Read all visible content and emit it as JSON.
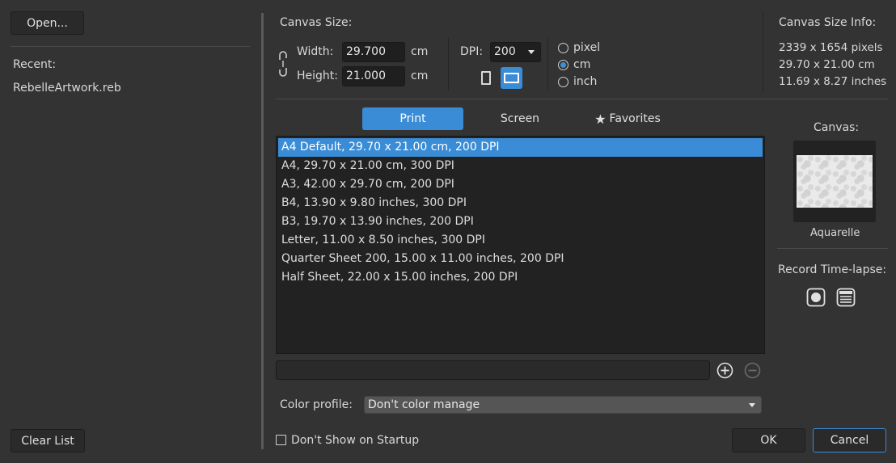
{
  "left_panel": {
    "open_label": "Open...",
    "recent_label": "Recent:",
    "recent_files": [
      "RebelleArtwork.reb"
    ],
    "clear_label": "Clear List"
  },
  "canvas_size": {
    "title": "Canvas Size:",
    "width_label": "Width:",
    "width_value": "29.700",
    "width_unit": "cm",
    "height_label": "Height:",
    "height_value": "21.000",
    "height_unit": "cm",
    "dpi_label": "DPI:",
    "dpi_value": "200",
    "orientation_selected": "landscape",
    "units": [
      {
        "label": "pixel",
        "selected": false
      },
      {
        "label": "cm",
        "selected": true
      },
      {
        "label": "inch",
        "selected": false
      }
    ]
  },
  "info": {
    "title": "Canvas Size Info:",
    "pixels": "2339 x 1654 pixels",
    "cm": "29.70 x 21.00 cm",
    "inches": "11.69 x 8.27 inches"
  },
  "tabs": [
    {
      "label": "Print",
      "active": true
    },
    {
      "label": "Screen",
      "active": false
    },
    {
      "label": "Favorites",
      "active": false
    }
  ],
  "presets": [
    "A4 Default, 29.70 x 21.00 cm, 200 DPI",
    "A4, 29.70 x 21.00 cm, 300 DPI",
    "A3, 42.00 x 29.70 cm, 200 DPI",
    "B4, 13.90 x 9.80 inches, 300 DPI",
    "B3, 19.70 x 13.90 inches, 200 DPI",
    "Letter, 11.00 x 8.50 inches, 300 DPI",
    "Quarter Sheet 200, 15.00 x 11.00 inches, 200 DPI",
    "Half Sheet, 22.00 x 15.00 inches, 200 DPI"
  ],
  "preset_name_value": "",
  "color_profile": {
    "label": "Color profile:",
    "value": "Don't color manage"
  },
  "canvas_panel": {
    "title": "Canvas:",
    "texture_name": "Aquarelle",
    "timelapse_title": "Record Time-lapse:"
  },
  "footer": {
    "dont_show_label": "Don't Show on Startup",
    "ok_label": "OK",
    "cancel_label": "Cancel"
  },
  "colors": {
    "accent": "#3a8cd6",
    "background": "#333333"
  }
}
